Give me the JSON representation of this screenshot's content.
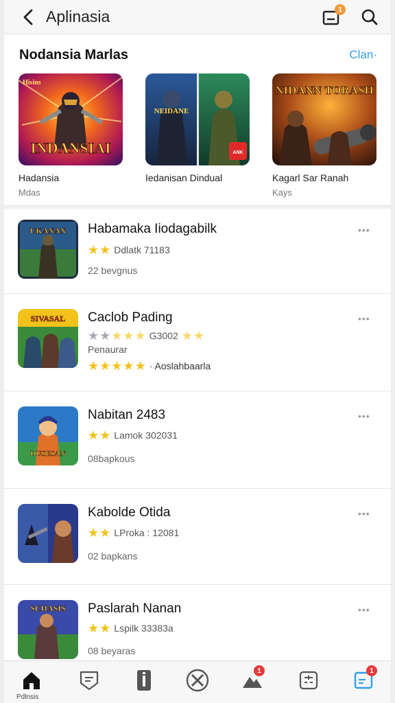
{
  "topbar": {
    "title": "Aplinasia",
    "notif_badge": "1"
  },
  "featured": {
    "title": "Nodansia Marlas",
    "link": "Clan",
    "cards": [
      {
        "art_text": "INDANSIAI",
        "art_corner": "Hisins",
        "name": "Hadansia",
        "sub": "Mdas"
      },
      {
        "art_text": "NEIDANE",
        "art_corner": "ANK",
        "name": "Iedanisan Dindual",
        "sub": ""
      },
      {
        "art_text": "NIDANN TORASH",
        "name": "Kagarl Sar Ranah",
        "sub": "Kays"
      }
    ]
  },
  "list": [
    {
      "title": "Habamaka Iiodagabilk",
      "icon_text": "UKANAN",
      "line1": "Ddlatk 71183",
      "line2": "22 bevgnus",
      "stars": [
        "y",
        "y"
      ]
    },
    {
      "title": "Caclob Pading",
      "icon_text": "SIVASAL",
      "line1": "G3002",
      "line2": "Penaurar",
      "line3": "· Aoslahbaarla",
      "stars": [
        "g",
        "g",
        "ly",
        "ly",
        "ly"
      ],
      "stars_after": [
        "ly",
        "ly"
      ],
      "stars3": [
        "y",
        "y",
        "y",
        "y",
        "y"
      ]
    },
    {
      "title": "Nabitan 2483",
      "icon_text": "DUSESAN",
      "line1": "Lamok 302031",
      "line2": "08bapkous",
      "stars": [
        "y",
        "y"
      ]
    },
    {
      "title": "Kabolde Otida",
      "icon_text": "",
      "line1": "LProka : 12081",
      "line2": "02 bapkans",
      "stars": [
        "y",
        "y"
      ]
    },
    {
      "title": "Paslarah Nanan",
      "icon_text": "SCHASIS",
      "line1": "Lspilk 33383a",
      "line2": "08 beyaras",
      "stars": [
        "y",
        "y"
      ]
    }
  ],
  "bottomnav": {
    "home_label": "Pdlnsis",
    "alerts_badge": "1",
    "profile_badge": "1"
  },
  "colors": {
    "accent": "#2f9ee8",
    "star": "#f2c21b",
    "badge": "#e33b3b",
    "badge_orange": "#f29a3b"
  }
}
